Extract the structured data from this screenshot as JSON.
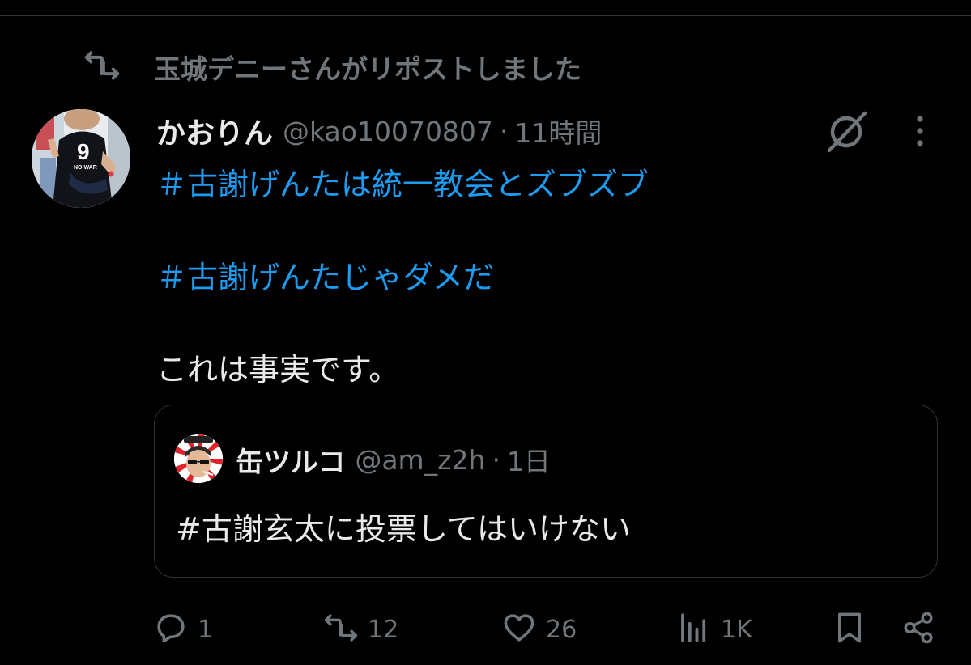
{
  "repost": {
    "label": "玉城デニーさんがリポストしました"
  },
  "tweet": {
    "display_name": "かおりん",
    "handle": "@kao10070807",
    "separator": "·",
    "time": "11時間",
    "hashtag_1": "＃古謝げんたは統一教会とズブズブ",
    "hashtag_2": "＃古謝げんたじゃダメだ",
    "body": "これは事実です。"
  },
  "quote": {
    "display_name": "缶ツルコ",
    "handle": "@am_z2h",
    "separator": "·",
    "time": "1日",
    "text": "#古謝玄太に投票してはいけない"
  },
  "actions": {
    "reply_count": "1",
    "repost_count": "12",
    "like_count": "26",
    "views_count": "1K"
  },
  "avatar_text": {
    "number": "9",
    "slogan": "NO WAR"
  },
  "colors": {
    "background": "#000000",
    "text_primary": "#e7e9ea",
    "text_secondary": "#71767b",
    "hashtag": "#1d9bf0",
    "border": "#2f3336"
  },
  "icons": {
    "repost": "repost-icon",
    "grok": "grok-icon",
    "more": "more-icon",
    "reply": "reply-icon",
    "like": "heart-icon",
    "views": "views-icon",
    "bookmark": "bookmark-icon",
    "share": "share-icon"
  }
}
